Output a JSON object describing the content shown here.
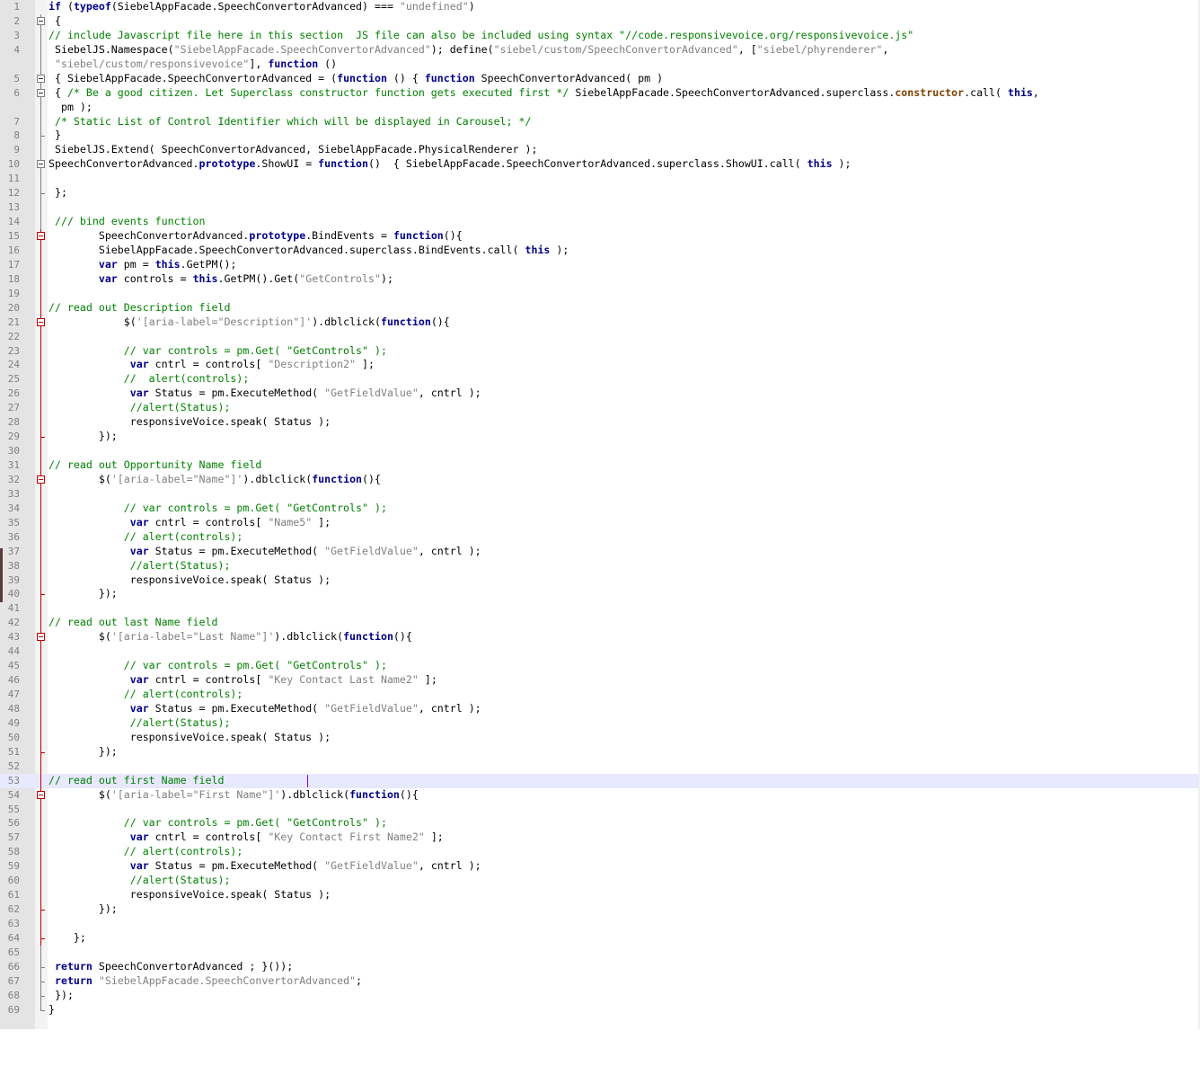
{
  "editor": {
    "current_line": 53,
    "lines": [
      {
        "n": "1",
        "fold": "none",
        "segs": [
          {
            "t": "if",
            "c": "k"
          },
          {
            "t": " ("
          },
          {
            "t": "typeof",
            "c": "k"
          },
          {
            "t": "(SiebelAppFacade.SpeechConvertorAdvanced) === "
          },
          {
            "t": "\"undefined\"",
            "c": "s"
          },
          {
            "t": ")"
          }
        ]
      },
      {
        "n": "2",
        "fold": "minus",
        "segs": [
          {
            "t": " {"
          }
        ]
      },
      {
        "n": "3",
        "fold": "line",
        "segs": [
          {
            "t": "// include Javascript file here in this section  JS file can also be included using syntax \"//code.responsivevoice.org/responsivevoice.js\"",
            "c": "c"
          }
        ]
      },
      {
        "n": "4",
        "fold": "line",
        "segs": [
          {
            "t": " SiebelJS.Namespace("
          },
          {
            "t": "\"SiebelAppFacade.SpeechConvertorAdvanced\"",
            "c": "s"
          },
          {
            "t": "); define("
          },
          {
            "t": "\"siebel/custom/SpeechConvertorAdvanced\"",
            "c": "s"
          },
          {
            "t": ", ["
          },
          {
            "t": "\"siebel/phyrenderer\"",
            "c": "s"
          },
          {
            "t": ","
          }
        ]
      },
      {
        "n": "",
        "fold": "line",
        "segs": [
          {
            "t": " "
          },
          {
            "t": "\"siebel/custom/responsivevoice\"",
            "c": "s"
          },
          {
            "t": "], "
          },
          {
            "t": "function",
            "c": "k"
          },
          {
            "t": " ()"
          }
        ]
      },
      {
        "n": "5",
        "fold": "minus",
        "segs": [
          {
            "t": " { SiebelAppFacade.SpeechConvertorAdvanced = ("
          },
          {
            "t": "function",
            "c": "k"
          },
          {
            "t": " () { "
          },
          {
            "t": "function",
            "c": "k"
          },
          {
            "t": " SpeechConvertorAdvanced( pm )"
          }
        ]
      },
      {
        "n": "6",
        "fold": "minus",
        "segs": [
          {
            "t": " { "
          },
          {
            "t": "/* Be a good citizen. Let Superclass constructor function gets executed first */",
            "c": "c"
          },
          {
            "t": " SiebelAppFacade.SpeechConvertorAdvanced.superclass."
          },
          {
            "t": "constructor",
            "c": "ctor"
          },
          {
            "t": ".call( "
          },
          {
            "t": "this",
            "c": "k"
          },
          {
            "t": ","
          }
        ]
      },
      {
        "n": "",
        "fold": "line",
        "segs": [
          {
            "t": "  pm );"
          }
        ]
      },
      {
        "n": "7",
        "fold": "line",
        "segs": [
          {
            "t": " /* Static List of Control Identifier which will be displayed in Carousel; */",
            "c": "c"
          }
        ]
      },
      {
        "n": "8",
        "fold": "tick",
        "segs": [
          {
            "t": " }"
          }
        ]
      },
      {
        "n": "9",
        "fold": "line",
        "segs": [
          {
            "t": " SiebelJS.Extend( SpeechConvertorAdvanced, SiebelAppFacade.PhysicalRenderer );"
          }
        ]
      },
      {
        "n": "10",
        "fold": "minus",
        "segs": [
          {
            "t": "SpeechConvertorAdvanced."
          },
          {
            "t": "prototype",
            "c": "k"
          },
          {
            "t": ".ShowUI = "
          },
          {
            "t": "function",
            "c": "k"
          },
          {
            "t": "()  { SiebelAppFacade.SpeechConvertorAdvanced.superclass.ShowUI.call( "
          },
          {
            "t": "this",
            "c": "k"
          },
          {
            "t": " );"
          }
        ]
      },
      {
        "n": "11",
        "fold": "line",
        "segs": [
          {
            "t": ""
          }
        ]
      },
      {
        "n": "12",
        "fold": "tick",
        "segs": [
          {
            "t": " };"
          }
        ]
      },
      {
        "n": "13",
        "fold": "line",
        "segs": [
          {
            "t": ""
          }
        ]
      },
      {
        "n": "14",
        "fold": "line",
        "segs": [
          {
            "t": " /// bind events function",
            "c": "c"
          }
        ]
      },
      {
        "n": "15",
        "fold": "redminus",
        "segs": [
          {
            "t": "        SpeechConvertorAdvanced."
          },
          {
            "t": "prototype",
            "c": "k"
          },
          {
            "t": ".BindEvents = "
          },
          {
            "t": "function",
            "c": "k"
          },
          {
            "t": "(){"
          }
        ]
      },
      {
        "n": "16",
        "fold": "redline",
        "segs": [
          {
            "t": "        SiebelAppFacade.SpeechConvertorAdvanced.superclass.BindEvents.call( "
          },
          {
            "t": "this",
            "c": "k"
          },
          {
            "t": " );"
          }
        ]
      },
      {
        "n": "17",
        "fold": "redline",
        "segs": [
          {
            "t": "        "
          },
          {
            "t": "var",
            "c": "k"
          },
          {
            "t": " pm = "
          },
          {
            "t": "this",
            "c": "k"
          },
          {
            "t": ".GetPM();"
          }
        ]
      },
      {
        "n": "18",
        "fold": "redline",
        "segs": [
          {
            "t": "        "
          },
          {
            "t": "var",
            "c": "k"
          },
          {
            "t": " controls = "
          },
          {
            "t": "this",
            "c": "k"
          },
          {
            "t": ".GetPM().Get("
          },
          {
            "t": "\"GetControls\"",
            "c": "s"
          },
          {
            "t": ");"
          }
        ]
      },
      {
        "n": "19",
        "fold": "redline",
        "segs": [
          {
            "t": ""
          }
        ]
      },
      {
        "n": "20",
        "fold": "redline",
        "segs": [
          {
            "t": "// read out Description field",
            "c": "c"
          }
        ]
      },
      {
        "n": "21",
        "fold": "redminus",
        "segs": [
          {
            "t": "            $("
          },
          {
            "t": "'[aria-label=\"Description\"]'",
            "c": "s"
          },
          {
            "t": ").dblclick("
          },
          {
            "t": "function",
            "c": "k"
          },
          {
            "t": "(){"
          }
        ]
      },
      {
        "n": "22",
        "fold": "redline",
        "segs": [
          {
            "t": ""
          }
        ]
      },
      {
        "n": "23",
        "fold": "redline",
        "segs": [
          {
            "t": "            // var controls = pm.Get( \"GetControls\" );",
            "c": "c"
          }
        ]
      },
      {
        "n": "24",
        "fold": "redline",
        "segs": [
          {
            "t": "             "
          },
          {
            "t": "var",
            "c": "k"
          },
          {
            "t": " cntrl = controls[ "
          },
          {
            "t": "\"Description2\"",
            "c": "s"
          },
          {
            "t": " ];"
          }
        ]
      },
      {
        "n": "25",
        "fold": "redline",
        "segs": [
          {
            "t": "            //  alert(controls);",
            "c": "c"
          }
        ]
      },
      {
        "n": "26",
        "fold": "redline",
        "segs": [
          {
            "t": "             "
          },
          {
            "t": "var",
            "c": "k"
          },
          {
            "t": " Status = pm.ExecuteMethod( "
          },
          {
            "t": "\"GetFieldValue\"",
            "c": "s"
          },
          {
            "t": ", cntrl );"
          }
        ]
      },
      {
        "n": "27",
        "fold": "redline",
        "segs": [
          {
            "t": "             //alert(Status);",
            "c": "c"
          }
        ]
      },
      {
        "n": "28",
        "fold": "redline",
        "segs": [
          {
            "t": "             responsiveVoice.speak( Status );"
          }
        ]
      },
      {
        "n": "29",
        "fold": "redtick",
        "segs": [
          {
            "t": "        });"
          }
        ]
      },
      {
        "n": "30",
        "fold": "redline",
        "segs": [
          {
            "t": ""
          }
        ]
      },
      {
        "n": "31",
        "fold": "redline",
        "segs": [
          {
            "t": "// read out Opportunity Name field",
            "c": "c"
          }
        ]
      },
      {
        "n": "32",
        "fold": "redminus",
        "segs": [
          {
            "t": "        $("
          },
          {
            "t": "'[aria-label=\"Name\"]'",
            "c": "s"
          },
          {
            "t": ").dblclick("
          },
          {
            "t": "function",
            "c": "k"
          },
          {
            "t": "(){"
          }
        ]
      },
      {
        "n": "33",
        "fold": "redline",
        "segs": [
          {
            "t": ""
          }
        ]
      },
      {
        "n": "34",
        "fold": "redline",
        "segs": [
          {
            "t": "            // var controls = pm.Get( \"GetControls\" );",
            "c": "c"
          }
        ]
      },
      {
        "n": "35",
        "fold": "redline",
        "segs": [
          {
            "t": "             "
          },
          {
            "t": "var",
            "c": "k"
          },
          {
            "t": " cntrl = controls[ "
          },
          {
            "t": "\"Name5\"",
            "c": "s"
          },
          {
            "t": " ];"
          }
        ]
      },
      {
        "n": "36",
        "fold": "redline",
        "segs": [
          {
            "t": "            // alert(controls);",
            "c": "c"
          }
        ]
      },
      {
        "n": "37",
        "fold": "redline",
        "segs": [
          {
            "t": "             "
          },
          {
            "t": "var",
            "c": "k"
          },
          {
            "t": " Status = pm.ExecuteMethod( "
          },
          {
            "t": "\"GetFieldValue\"",
            "c": "s"
          },
          {
            "t": ", cntrl );"
          }
        ]
      },
      {
        "n": "38",
        "fold": "redline",
        "segs": [
          {
            "t": "             //alert(Status);",
            "c": "c"
          }
        ]
      },
      {
        "n": "39",
        "fold": "redline",
        "segs": [
          {
            "t": "             responsiveVoice.speak( Status );"
          }
        ]
      },
      {
        "n": "40",
        "fold": "redtick",
        "segs": [
          {
            "t": "        });"
          }
        ]
      },
      {
        "n": "41",
        "fold": "redline",
        "segs": [
          {
            "t": ""
          }
        ]
      },
      {
        "n": "42",
        "fold": "redline",
        "segs": [
          {
            "t": "// read out last Name field",
            "c": "c"
          }
        ]
      },
      {
        "n": "43",
        "fold": "redminus",
        "segs": [
          {
            "t": "        $("
          },
          {
            "t": "'[aria-label=\"Last Name\"]'",
            "c": "s"
          },
          {
            "t": ").dblclick("
          },
          {
            "t": "function",
            "c": "k"
          },
          {
            "t": "(){"
          }
        ]
      },
      {
        "n": "44",
        "fold": "redline",
        "segs": [
          {
            "t": ""
          }
        ]
      },
      {
        "n": "45",
        "fold": "redline",
        "segs": [
          {
            "t": "            // var controls = pm.Get( \"GetControls\" );",
            "c": "c"
          }
        ]
      },
      {
        "n": "46",
        "fold": "redline",
        "segs": [
          {
            "t": "             "
          },
          {
            "t": "var",
            "c": "k"
          },
          {
            "t": " cntrl = controls[ "
          },
          {
            "t": "\"Key Contact Last Name2\"",
            "c": "s"
          },
          {
            "t": " ];"
          }
        ]
      },
      {
        "n": "47",
        "fold": "redline",
        "segs": [
          {
            "t": "            // alert(controls);",
            "c": "c"
          }
        ]
      },
      {
        "n": "48",
        "fold": "redline",
        "segs": [
          {
            "t": "             "
          },
          {
            "t": "var",
            "c": "k"
          },
          {
            "t": " Status = pm.ExecuteMethod( "
          },
          {
            "t": "\"GetFieldValue\"",
            "c": "s"
          },
          {
            "t": ", cntrl );"
          }
        ]
      },
      {
        "n": "49",
        "fold": "redline",
        "segs": [
          {
            "t": "             //alert(Status);",
            "c": "c"
          }
        ]
      },
      {
        "n": "50",
        "fold": "redline",
        "segs": [
          {
            "t": "             responsiveVoice.speak( Status );"
          }
        ]
      },
      {
        "n": "51",
        "fold": "redtick",
        "segs": [
          {
            "t": "        });"
          }
        ]
      },
      {
        "n": "52",
        "fold": "redline",
        "segs": [
          {
            "t": ""
          }
        ]
      },
      {
        "n": "53",
        "fold": "redline",
        "segs": [
          {
            "t": "// read out first Name field",
            "c": "c"
          }
        ]
      },
      {
        "n": "54",
        "fold": "redminus",
        "segs": [
          {
            "t": "        $("
          },
          {
            "t": "'[aria-label=\"First Name\"]'",
            "c": "s"
          },
          {
            "t": ").dblclick("
          },
          {
            "t": "function",
            "c": "k"
          },
          {
            "t": "(){"
          }
        ]
      },
      {
        "n": "55",
        "fold": "redline",
        "segs": [
          {
            "t": ""
          }
        ]
      },
      {
        "n": "56",
        "fold": "redline",
        "segs": [
          {
            "t": "            // var controls = pm.Get( \"GetControls\" );",
            "c": "c"
          }
        ]
      },
      {
        "n": "57",
        "fold": "redline",
        "segs": [
          {
            "t": "             "
          },
          {
            "t": "var",
            "c": "k"
          },
          {
            "t": " cntrl = controls[ "
          },
          {
            "t": "\"Key Contact First Name2\"",
            "c": "s"
          },
          {
            "t": " ];"
          }
        ]
      },
      {
        "n": "58",
        "fold": "redline",
        "segs": [
          {
            "t": "            // alert(controls);",
            "c": "c"
          }
        ]
      },
      {
        "n": "59",
        "fold": "redline",
        "segs": [
          {
            "t": "             "
          },
          {
            "t": "var",
            "c": "k"
          },
          {
            "t": " Status = pm.ExecuteMethod( "
          },
          {
            "t": "\"GetFieldValue\"",
            "c": "s"
          },
          {
            "t": ", cntrl );"
          }
        ]
      },
      {
        "n": "60",
        "fold": "redline",
        "segs": [
          {
            "t": "             //alert(Status);",
            "c": "c"
          }
        ]
      },
      {
        "n": "61",
        "fold": "redline",
        "segs": [
          {
            "t": "             responsiveVoice.speak( Status );"
          }
        ]
      },
      {
        "n": "62",
        "fold": "redtick",
        "segs": [
          {
            "t": "        });"
          }
        ]
      },
      {
        "n": "63",
        "fold": "redline",
        "segs": [
          {
            "t": ""
          }
        ]
      },
      {
        "n": "64",
        "fold": "redtick",
        "segs": [
          {
            "t": "    };"
          }
        ]
      },
      {
        "n": "65",
        "fold": "line",
        "segs": [
          {
            "t": ""
          }
        ]
      },
      {
        "n": "66",
        "fold": "tick",
        "segs": [
          {
            "t": " "
          },
          {
            "t": "return",
            "c": "k"
          },
          {
            "t": " SpeechConvertorAdvanced ; }());"
          }
        ]
      },
      {
        "n": "67",
        "fold": "tick",
        "segs": [
          {
            "t": " "
          },
          {
            "t": "return",
            "c": "k"
          },
          {
            "t": " "
          },
          {
            "t": "\"SiebelAppFacade.SpeechConvertorAdvanced\"",
            "c": "s"
          },
          {
            "t": ";"
          }
        ]
      },
      {
        "n": "68",
        "fold": "tick",
        "segs": [
          {
            "t": " });"
          }
        ]
      },
      {
        "n": "69",
        "fold": "end",
        "segs": [
          {
            "t": "}"
          }
        ]
      }
    ]
  }
}
